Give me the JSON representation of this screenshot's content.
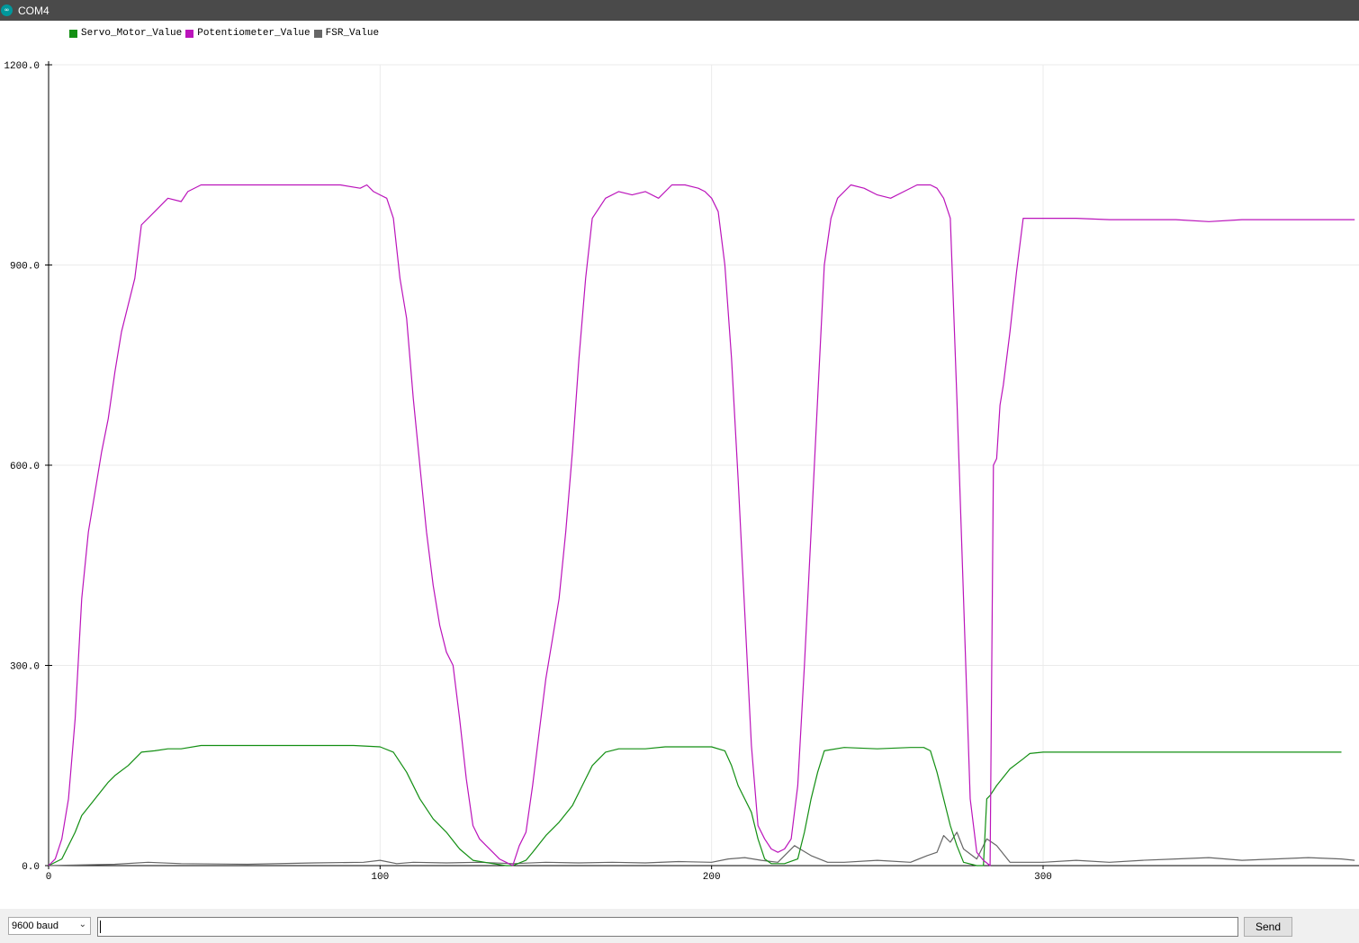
{
  "window": {
    "title": "COM4",
    "icon": "arduino-icon"
  },
  "legend": [
    {
      "label": "Servo_Motor_Value",
      "color": "#138f13"
    },
    {
      "label": "Potentiometer_Value",
      "color": "#bb14bb"
    },
    {
      "label": "FSR_Value",
      "color": "#666666"
    }
  ],
  "chart_data": {
    "type": "line",
    "x_ticks": [
      "0",
      "100",
      "200",
      "300"
    ],
    "y_ticks": [
      "0.0",
      "300.0",
      "600.0",
      "900.0",
      "1200.0"
    ],
    "xlim": [
      0,
      394
    ],
    "ylim": [
      0,
      1200
    ],
    "grid": true,
    "legend_position": "top-left",
    "series": [
      {
        "name": "Servo_Motor_Value",
        "color": "#138f13",
        "points": [
          [
            0,
            0
          ],
          [
            4,
            10
          ],
          [
            8,
            50
          ],
          [
            10,
            75
          ],
          [
            14,
            100
          ],
          [
            18,
            125
          ],
          [
            20,
            135
          ],
          [
            24,
            150
          ],
          [
            26,
            160
          ],
          [
            28,
            170
          ],
          [
            32,
            172
          ],
          [
            36,
            175
          ],
          [
            40,
            175
          ],
          [
            46,
            180
          ],
          [
            60,
            180
          ],
          [
            80,
            180
          ],
          [
            92,
            180
          ],
          [
            100,
            178
          ],
          [
            104,
            170
          ],
          [
            108,
            140
          ],
          [
            112,
            100
          ],
          [
            116,
            70
          ],
          [
            120,
            50
          ],
          [
            124,
            25
          ],
          [
            128,
            8
          ],
          [
            134,
            3
          ],
          [
            138,
            0
          ],
          [
            140,
            0
          ],
          [
            144,
            8
          ],
          [
            146,
            20
          ],
          [
            150,
            45
          ],
          [
            154,
            65
          ],
          [
            158,
            90
          ],
          [
            162,
            130
          ],
          [
            164,
            150
          ],
          [
            168,
            170
          ],
          [
            172,
            175
          ],
          [
            180,
            175
          ],
          [
            186,
            178
          ],
          [
            200,
            178
          ],
          [
            204,
            172
          ],
          [
            206,
            150
          ],
          [
            208,
            120
          ],
          [
            212,
            80
          ],
          [
            214,
            40
          ],
          [
            216,
            10
          ],
          [
            218,
            3
          ],
          [
            222,
            3
          ],
          [
            226,
            10
          ],
          [
            228,
            50
          ],
          [
            230,
            100
          ],
          [
            232,
            140
          ],
          [
            234,
            172
          ],
          [
            240,
            177
          ],
          [
            250,
            175
          ],
          [
            260,
            177
          ],
          [
            264,
            177
          ],
          [
            266,
            172
          ],
          [
            268,
            140
          ],
          [
            270,
            100
          ],
          [
            272,
            60
          ],
          [
            274,
            30
          ],
          [
            276,
            5
          ],
          [
            280,
            0
          ],
          [
            282,
            0
          ],
          [
            283,
            100
          ],
          [
            284,
            105
          ],
          [
            286,
            120
          ],
          [
            290,
            145
          ],
          [
            294,
            160
          ],
          [
            296,
            168
          ],
          [
            300,
            170
          ],
          [
            320,
            170
          ],
          [
            340,
            170
          ],
          [
            360,
            170
          ],
          [
            380,
            170
          ],
          [
            390,
            170
          ]
        ]
      },
      {
        "name": "Potentiometer_Value",
        "color": "#bb14bb",
        "points": [
          [
            0,
            0
          ],
          [
            2,
            10
          ],
          [
            4,
            40
          ],
          [
            6,
            100
          ],
          [
            8,
            220
          ],
          [
            10,
            400
          ],
          [
            12,
            500
          ],
          [
            14,
            560
          ],
          [
            16,
            620
          ],
          [
            18,
            670
          ],
          [
            20,
            740
          ],
          [
            22,
            800
          ],
          [
            24,
            840
          ],
          [
            26,
            880
          ],
          [
            28,
            960
          ],
          [
            32,
            980
          ],
          [
            36,
            1000
          ],
          [
            40,
            995
          ],
          [
            42,
            1010
          ],
          [
            46,
            1020
          ],
          [
            50,
            1020
          ],
          [
            60,
            1020
          ],
          [
            70,
            1020
          ],
          [
            80,
            1020
          ],
          [
            88,
            1020
          ],
          [
            94,
            1015
          ],
          [
            96,
            1020
          ],
          [
            98,
            1010
          ],
          [
            100,
            1005
          ],
          [
            102,
            1000
          ],
          [
            104,
            970
          ],
          [
            106,
            880
          ],
          [
            108,
            820
          ],
          [
            110,
            700
          ],
          [
            112,
            600
          ],
          [
            114,
            500
          ],
          [
            116,
            420
          ],
          [
            118,
            360
          ],
          [
            120,
            320
          ],
          [
            122,
            300
          ],
          [
            124,
            220
          ],
          [
            126,
            130
          ],
          [
            128,
            60
          ],
          [
            130,
            40
          ],
          [
            132,
            30
          ],
          [
            134,
            20
          ],
          [
            136,
            10
          ],
          [
            138,
            5
          ],
          [
            140,
            0
          ],
          [
            142,
            30
          ],
          [
            144,
            50
          ],
          [
            146,
            120
          ],
          [
            148,
            200
          ],
          [
            150,
            280
          ],
          [
            152,
            340
          ],
          [
            154,
            400
          ],
          [
            156,
            500
          ],
          [
            158,
            620
          ],
          [
            160,
            760
          ],
          [
            162,
            880
          ],
          [
            164,
            970
          ],
          [
            168,
            1000
          ],
          [
            172,
            1010
          ],
          [
            176,
            1005
          ],
          [
            180,
            1010
          ],
          [
            184,
            1000
          ],
          [
            188,
            1020
          ],
          [
            192,
            1020
          ],
          [
            196,
            1015
          ],
          [
            198,
            1010
          ],
          [
            200,
            1000
          ],
          [
            202,
            980
          ],
          [
            204,
            900
          ],
          [
            206,
            760
          ],
          [
            208,
            580
          ],
          [
            210,
            380
          ],
          [
            212,
            180
          ],
          [
            214,
            60
          ],
          [
            216,
            40
          ],
          [
            218,
            25
          ],
          [
            220,
            20
          ],
          [
            222,
            25
          ],
          [
            224,
            40
          ],
          [
            226,
            120
          ],
          [
            228,
            300
          ],
          [
            230,
            500
          ],
          [
            232,
            700
          ],
          [
            234,
            900
          ],
          [
            236,
            970
          ],
          [
            238,
            1000
          ],
          [
            242,
            1020
          ],
          [
            246,
            1015
          ],
          [
            250,
            1005
          ],
          [
            254,
            1000
          ],
          [
            258,
            1010
          ],
          [
            262,
            1020
          ],
          [
            266,
            1020
          ],
          [
            268,
            1015
          ],
          [
            270,
            1000
          ],
          [
            272,
            970
          ],
          [
            274,
            700
          ],
          [
            276,
            400
          ],
          [
            278,
            100
          ],
          [
            280,
            20
          ],
          [
            282,
            8
          ],
          [
            284,
            0
          ],
          [
            285,
            600
          ],
          [
            286,
            610
          ],
          [
            287,
            690
          ],
          [
            288,
            720
          ],
          [
            290,
            800
          ],
          [
            292,
            890
          ],
          [
            294,
            970
          ],
          [
            298,
            970
          ],
          [
            302,
            970
          ],
          [
            310,
            970
          ],
          [
            320,
            968
          ],
          [
            330,
            968
          ],
          [
            340,
            968
          ],
          [
            350,
            965
          ],
          [
            360,
            968
          ],
          [
            370,
            968
          ],
          [
            380,
            968
          ],
          [
            390,
            968
          ],
          [
            394,
            968
          ]
        ]
      },
      {
        "name": "FSR_Value",
        "color": "#666666",
        "points": [
          [
            0,
            0
          ],
          [
            20,
            2
          ],
          [
            30,
            5
          ],
          [
            40,
            3
          ],
          [
            60,
            2
          ],
          [
            80,
            4
          ],
          [
            95,
            5
          ],
          [
            100,
            8
          ],
          [
            105,
            3
          ],
          [
            110,
            5
          ],
          [
            120,
            4
          ],
          [
            130,
            5
          ],
          [
            140,
            3
          ],
          [
            150,
            5
          ],
          [
            160,
            4
          ],
          [
            170,
            5
          ],
          [
            180,
            4
          ],
          [
            190,
            6
          ],
          [
            200,
            5
          ],
          [
            205,
            10
          ],
          [
            210,
            12
          ],
          [
            215,
            8
          ],
          [
            220,
            5
          ],
          [
            225,
            30
          ],
          [
            230,
            15
          ],
          [
            235,
            5
          ],
          [
            240,
            5
          ],
          [
            250,
            8
          ],
          [
            260,
            5
          ],
          [
            265,
            15
          ],
          [
            268,
            20
          ],
          [
            270,
            45
          ],
          [
            272,
            35
          ],
          [
            274,
            50
          ],
          [
            276,
            25
          ],
          [
            280,
            10
          ],
          [
            283,
            40
          ],
          [
            286,
            30
          ],
          [
            290,
            5
          ],
          [
            300,
            5
          ],
          [
            310,
            8
          ],
          [
            320,
            5
          ],
          [
            330,
            8
          ],
          [
            340,
            10
          ],
          [
            350,
            12
          ],
          [
            360,
            8
          ],
          [
            370,
            10
          ],
          [
            380,
            12
          ],
          [
            390,
            10
          ],
          [
            394,
            8
          ]
        ]
      }
    ]
  },
  "bottom": {
    "baud": "9600 baud",
    "input_value": "",
    "send_label": "Send"
  }
}
